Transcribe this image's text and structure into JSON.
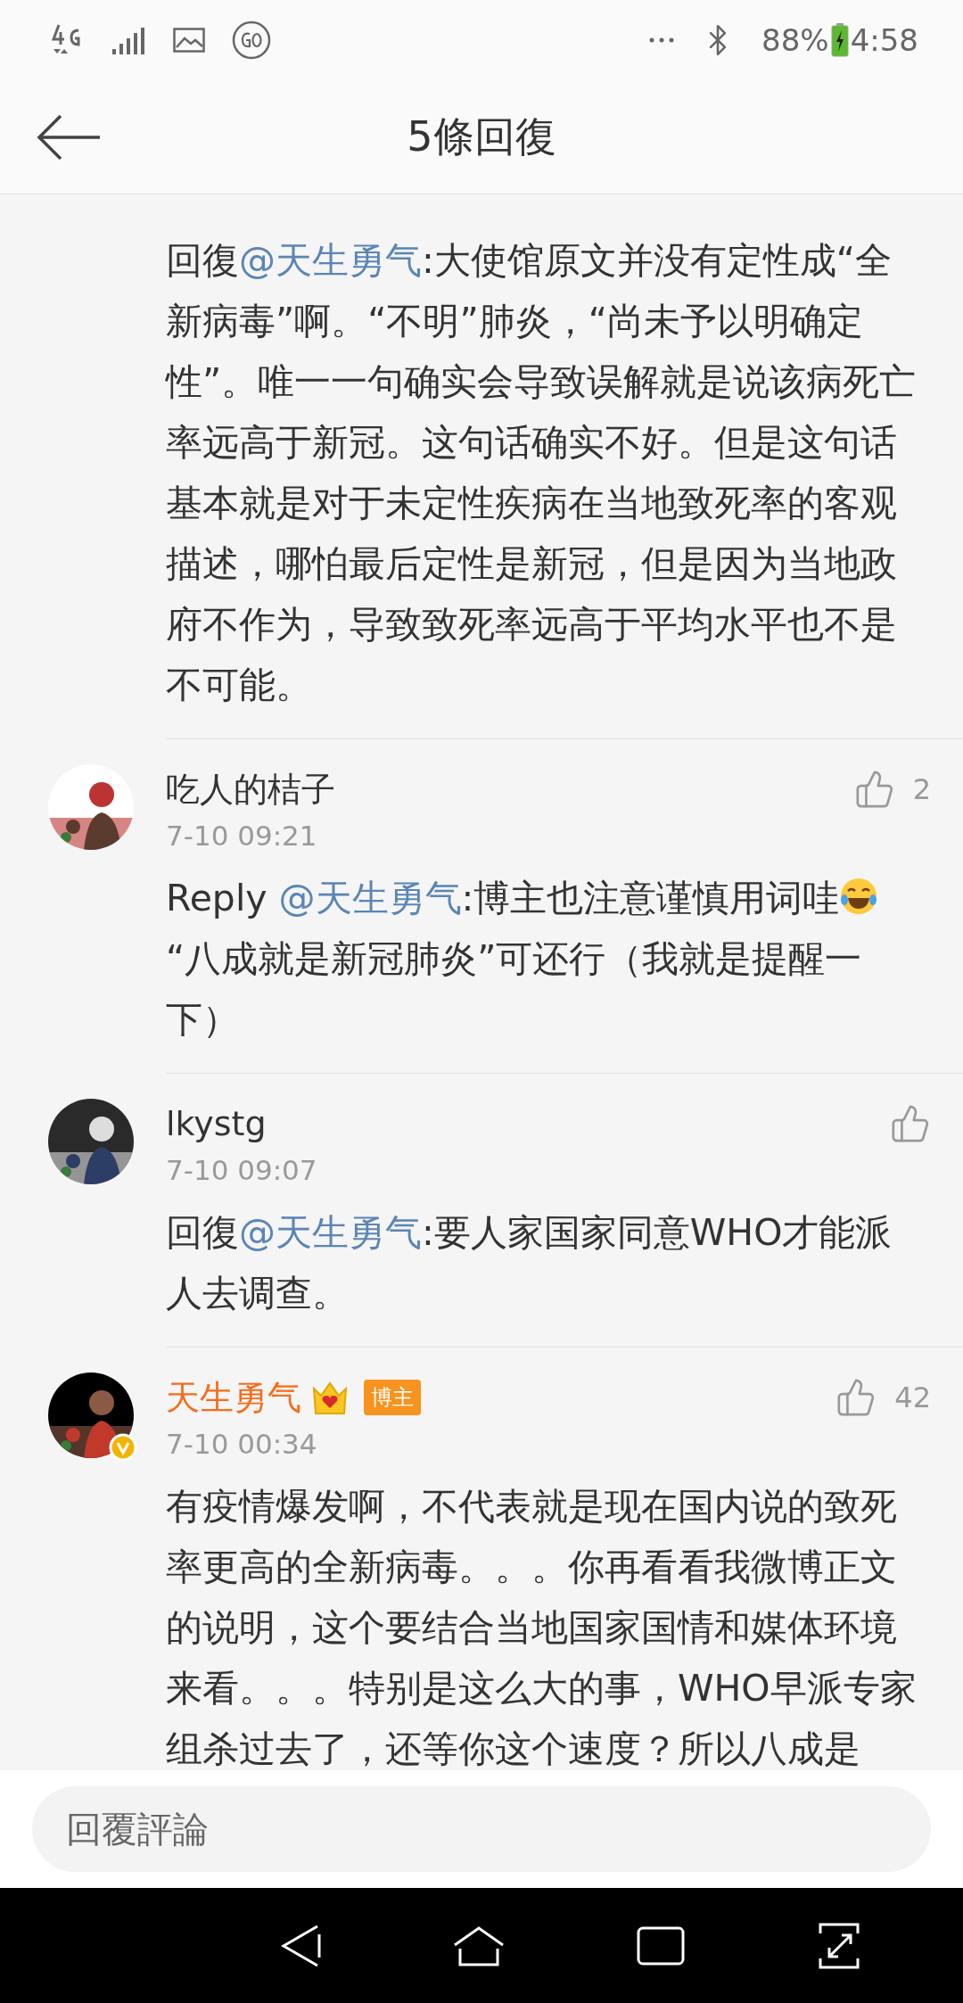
{
  "status_bar": {
    "battery": "88%",
    "time": "4:58"
  },
  "header": {
    "title": "5條回復"
  },
  "comments": [
    {
      "body": [
        {
          "kind": "text",
          "text": "回復"
        },
        {
          "kind": "mention",
          "text": "@天生勇气"
        },
        {
          "kind": "text",
          "text": ":大使馆原文并没有定性成“全新病毒”啊。“不明”肺炎，“尚未予以明确定性”。唯一一句确实会导致误解就是说该病死亡率远高于新冠。这句话确实不好。但是这句话基本就是对于未定性疾病在当地致死率的客观描述，哪怕最后定性是新冠，但是因为当地政府不作为，导致致死率远高于平均水平也不是不可能。"
        }
      ]
    },
    {
      "author": "吃人的桔子",
      "is_blogger": false,
      "time": "7-10 09:21",
      "likes": "2",
      "body": [
        {
          "kind": "text",
          "text": "Reply "
        },
        {
          "kind": "mention",
          "text": "@天生勇气"
        },
        {
          "kind": "text",
          "text": ":博主也注意谨慎用词哇"
        },
        {
          "kind": "emoji"
        },
        {
          "kind": "text",
          "text": "“八成就是新冠肺炎”可还行（我就是提醒一下）"
        }
      ]
    },
    {
      "author": "lkystg",
      "is_blogger": false,
      "time": "7-10 09:07",
      "body": [
        {
          "kind": "text",
          "text": "回復"
        },
        {
          "kind": "mention",
          "text": "@天生勇气"
        },
        {
          "kind": "text",
          "text": ":要人家国家同意WHO才能派人去调查。"
        }
      ]
    },
    {
      "author": "天生勇气",
      "is_blogger": true,
      "crown": true,
      "verified": true,
      "tag": "博主",
      "time": "7-10 00:34",
      "likes": "42",
      "body": [
        {
          "kind": "text",
          "text": "有疫情爆发啊，不代表就是现在国内说的致死率更高的全新病毒。。。你再看看我微博正文的说明，这个要结合当地国家国情和媒体环境来看。。。特别是这么大的事，WHO早派专家组杀过去了，还等你这个速度？所以八成是"
        }
      ]
    }
  ],
  "reply_input": {
    "placeholder": "回覆評論"
  }
}
